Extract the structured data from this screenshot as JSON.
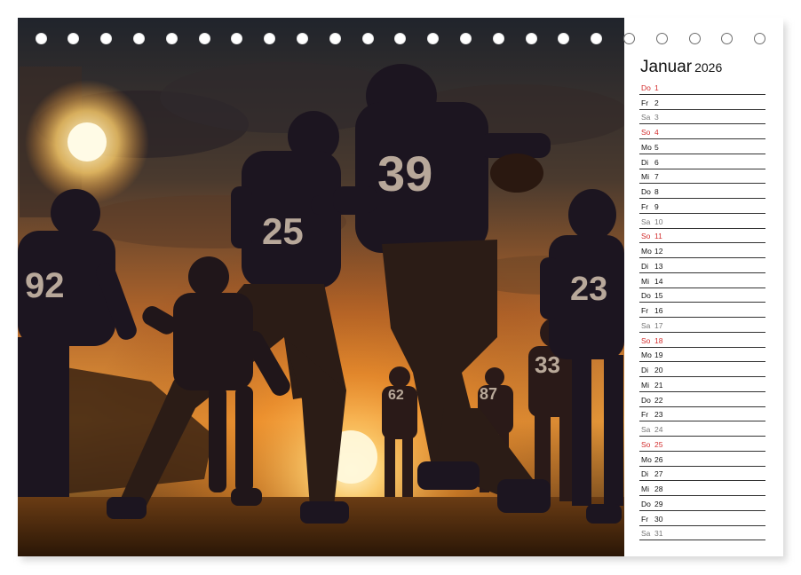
{
  "calendar": {
    "month": "Januar",
    "year": "2026",
    "days": [
      {
        "wd": "Do",
        "d": "1",
        "type": "sun"
      },
      {
        "wd": "Fr",
        "d": "2",
        "type": "week"
      },
      {
        "wd": "Sa",
        "d": "3",
        "type": "sat"
      },
      {
        "wd": "So",
        "d": "4",
        "type": "sun"
      },
      {
        "wd": "Mo",
        "d": "5",
        "type": "week"
      },
      {
        "wd": "Di",
        "d": "6",
        "type": "week"
      },
      {
        "wd": "Mi",
        "d": "7",
        "type": "week"
      },
      {
        "wd": "Do",
        "d": "8",
        "type": "week"
      },
      {
        "wd": "Fr",
        "d": "9",
        "type": "week"
      },
      {
        "wd": "Sa",
        "d": "10",
        "type": "sat"
      },
      {
        "wd": "So",
        "d": "11",
        "type": "sun"
      },
      {
        "wd": "Mo",
        "d": "12",
        "type": "week"
      },
      {
        "wd": "Di",
        "d": "13",
        "type": "week"
      },
      {
        "wd": "Mi",
        "d": "14",
        "type": "week"
      },
      {
        "wd": "Do",
        "d": "15",
        "type": "week"
      },
      {
        "wd": "Fr",
        "d": "16",
        "type": "week"
      },
      {
        "wd": "Sa",
        "d": "17",
        "type": "sat"
      },
      {
        "wd": "So",
        "d": "18",
        "type": "sun"
      },
      {
        "wd": "Mo",
        "d": "19",
        "type": "week"
      },
      {
        "wd": "Di",
        "d": "20",
        "type": "week"
      },
      {
        "wd": "Mi",
        "d": "21",
        "type": "week"
      },
      {
        "wd": "Do",
        "d": "22",
        "type": "week"
      },
      {
        "wd": "Fr",
        "d": "23",
        "type": "week"
      },
      {
        "wd": "Sa",
        "d": "24",
        "type": "sat"
      },
      {
        "wd": "So",
        "d": "25",
        "type": "sun"
      },
      {
        "wd": "Mo",
        "d": "26",
        "type": "week"
      },
      {
        "wd": "Di",
        "d": "27",
        "type": "week"
      },
      {
        "wd": "Mi",
        "d": "28",
        "type": "week"
      },
      {
        "wd": "Do",
        "d": "29",
        "type": "week"
      },
      {
        "wd": "Fr",
        "d": "30",
        "type": "week"
      },
      {
        "wd": "Sa",
        "d": "31",
        "type": "sat"
      }
    ]
  },
  "photo": {
    "jersey_numbers": [
      "92",
      "25",
      "39",
      "23",
      "33",
      "87",
      "62"
    ]
  },
  "colors": {
    "sunday": "#d32f2f",
    "saturday": "#777777",
    "weekday": "#111111",
    "sky_glow": "#ffb84d",
    "jersey": "#1c1520"
  }
}
